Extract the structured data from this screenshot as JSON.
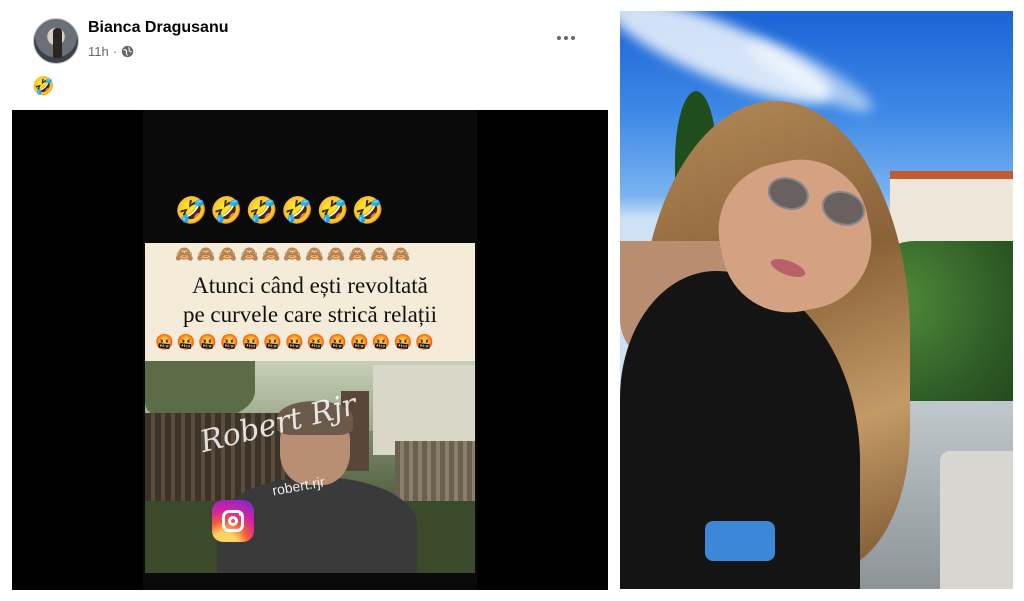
{
  "post": {
    "author": "Bianca Dragusanu",
    "time": "11h",
    "separator": "·",
    "audience_icon": "globe-icon",
    "more_icon": "more-options-icon",
    "caption": "🤣"
  },
  "video": {
    "emoji_row": "🤣🤣🤣🤣🤣🤣",
    "monkey_row": "🙈🙈🙈🙈🙈🙈🙈🙈🙈🙈🙈",
    "meme_line1": "Atunci când ești revoltată",
    "meme_line2": "pe curvele care strică relații",
    "angry_row": "🤬🤬🤬🤬🤬🤬🤬🤬🤬🤬🤬🤬🤬",
    "watermark": "Robert Rjr",
    "handle": "robert.rjr",
    "instagram_icon": "instagram-icon"
  },
  "photo": {
    "description_icon": "photo"
  }
}
